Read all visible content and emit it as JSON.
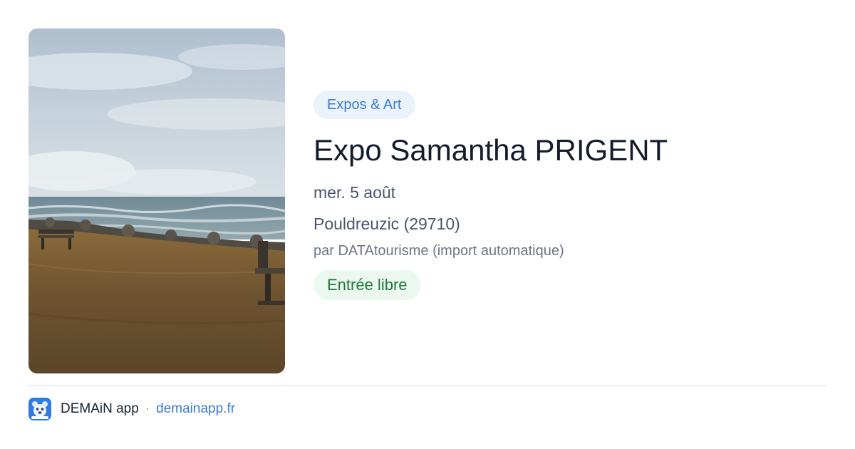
{
  "event": {
    "category": "Expos & Art",
    "title": "Expo Samantha PRIGENT",
    "date": "mer. 5 août",
    "location": "Pouldreuzic (29710)",
    "source": "par DATAtourisme (import automatique)",
    "price": "Entrée libre"
  },
  "footer": {
    "app_name": "DEMAiN app",
    "separator": "·",
    "site": "demainapp.fr"
  },
  "colors": {
    "category_bg": "#eaf2fc",
    "category_text": "#3b7ad1",
    "price_bg": "#ecf8ef",
    "price_text": "#1f7a3a",
    "title_text": "#141c2c",
    "link": "#3b7ad1"
  },
  "icons": {
    "app": "demain-app-icon"
  }
}
